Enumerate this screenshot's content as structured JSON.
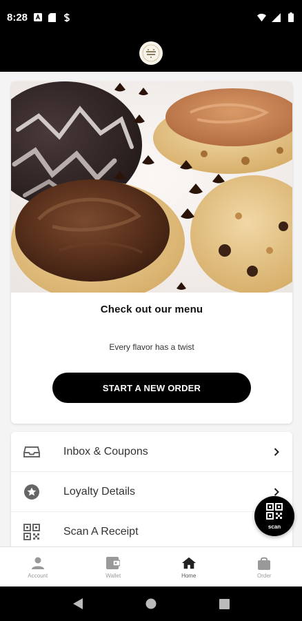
{
  "status_bar": {
    "time": "8:28",
    "notification_icons": [
      "a-box-icon",
      "sd-card-icon",
      "s-cycle-icon"
    ],
    "system_icons": [
      "wifi-icon",
      "signal-icon",
      "battery-icon"
    ]
  },
  "app_bar": {
    "logo": "crumbl-logo-icon"
  },
  "hero_card": {
    "image": "cookies-photo",
    "title": "Check out our menu",
    "subtitle": "Every flavor has a twist",
    "cta_label": "START A NEW ORDER"
  },
  "menu": {
    "items": [
      {
        "label": "Inbox & Coupons",
        "icon": "inbox-icon"
      },
      {
        "label": "Loyalty Details",
        "icon": "star-badge-icon"
      },
      {
        "label": "Scan A Receipt",
        "icon": "qr-code-icon"
      }
    ]
  },
  "fab": {
    "label": "scan",
    "icon": "qr-code-icon"
  },
  "bottom_nav": {
    "items": [
      {
        "label": "Account",
        "icon": "person-icon"
      },
      {
        "label": "Wallet",
        "icon": "wallet-icon"
      },
      {
        "label": "Home",
        "icon": "home-icon",
        "active": true
      },
      {
        "label": "Order",
        "icon": "shopping-bag-icon"
      }
    ]
  },
  "colors": {
    "bar_black": "#000000",
    "background": "#f4f4f4",
    "card": "#ffffff",
    "cta": "#000000",
    "inactive_nav": "#999999"
  }
}
